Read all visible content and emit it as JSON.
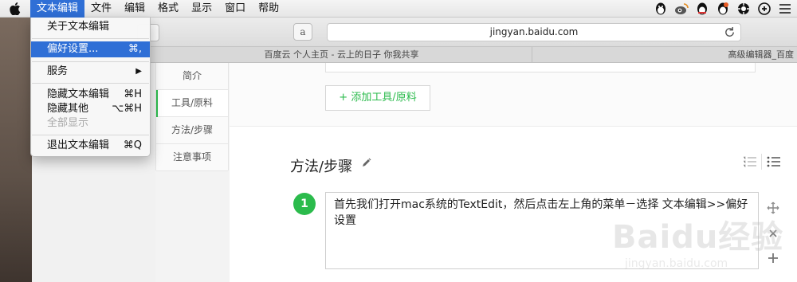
{
  "menubar": {
    "items": [
      "文本编辑",
      "文件",
      "编辑",
      "格式",
      "显示",
      "窗口",
      "帮助"
    ],
    "active_index": 0,
    "tray_icons": [
      "qq-penguin-icon",
      "weibo-icon",
      "qq-penguin-icon",
      "qq-penguin-icon",
      "gear-icon",
      "game-controller-icon",
      "list-icon"
    ]
  },
  "app_menu": {
    "items": [
      {
        "label": "关于文本编辑",
        "shortcut": ""
      },
      {
        "label": "偏好设置...",
        "shortcut": "⌘,",
        "highlighted": true
      },
      {
        "label": "服务",
        "shortcut": "▶"
      },
      {
        "label": "隐藏文本编辑",
        "shortcut": "⌘H"
      },
      {
        "label": "隐藏其他",
        "shortcut": "⌥⌘H"
      },
      {
        "label": "全部显示",
        "shortcut": "",
        "disabled": true
      },
      {
        "label": "退出文本编辑",
        "shortcut": "⌘Q"
      }
    ]
  },
  "browser": {
    "address": "jingyan.baidu.com",
    "amazon_button": "a",
    "tabs": [
      "百度云 个人主页 - 云上的日子 你我共享",
      "高级编辑器_百度"
    ]
  },
  "sidenav": {
    "items": [
      "简介",
      "工具/原料",
      "方法/步骤",
      "注意事项"
    ],
    "active_index": 1
  },
  "editor": {
    "add_tool_button": "+ 添加工具/原料",
    "section_title": "方法/步骤",
    "step": {
      "number": "1",
      "text": "首先我们打开mac系统的TextEdit，然后点击左上角的菜单－选择 文本编辑>>偏好设置"
    },
    "watermark": {
      "brand": "Baidu经验",
      "url": "jingyan.baidu.com"
    }
  },
  "colors": {
    "accent_green": "#2bbb4c",
    "menu_highlight": "#2f6fd6"
  }
}
